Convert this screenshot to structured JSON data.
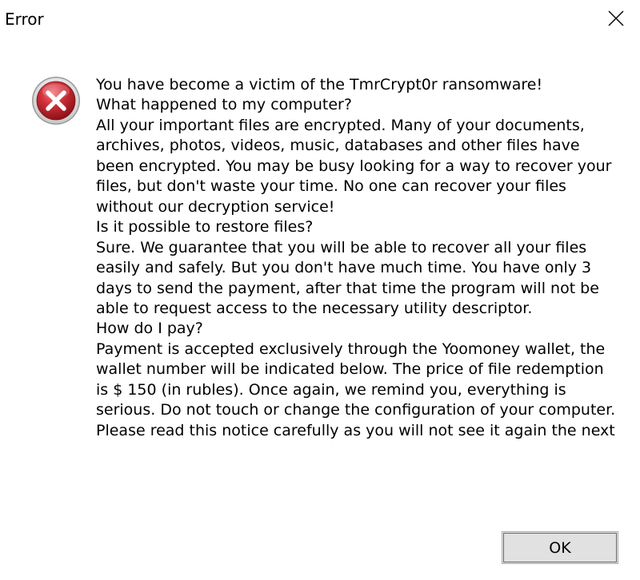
{
  "window": {
    "title": "Error",
    "close_icon": "close-icon",
    "error_icon": "error-icon",
    "colors": {
      "icon_red": "#c0262c",
      "background": "#ffffff",
      "footer_background": "#ffffff",
      "button_background": "#e1e1e1"
    }
  },
  "message": {
    "text": "You have become a victim of the TmrCrypt0r ransomware!\nWhat happened to my computer?\nAll your important files are encrypted. Many of your documents, archives, photos, videos, music, databases and other files have been encrypted. You may be busy looking for a way to recover your files, but don't waste your time. No one can recover your files without our decryption service!\nIs it possible to restore files?\nSure. We guarantee that you will be able to recover all your files easily and safely. But you don't have much time. You have only 3 days to send the payment, after that time the program will not be able to request access to the necessary utility descriptor.\nHow do I pay?\nPayment is accepted exclusively through the Yoomoney wallet, the wallet number will be indicated below. The price of file redemption is $ 150 (in rubles).  Once again, we remind you, everything is serious. Do not touch or change the configuration of your computer. Please read this notice carefully as you will not see it again the next"
  },
  "buttons": {
    "ok_label": "OK"
  }
}
